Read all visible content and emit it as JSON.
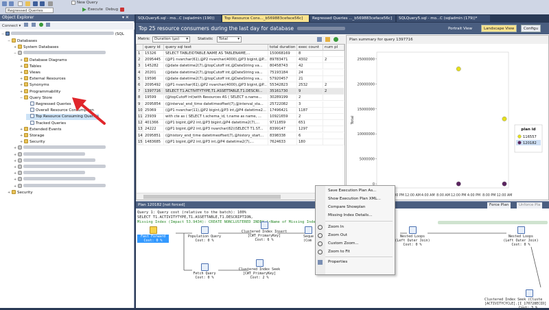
{
  "toolbar": {
    "regressed_label": "Regressed Queries",
    "new_query_label": "New Query",
    "execute_label": "Execute",
    "debug_label": "Debug"
  },
  "object_explorer": {
    "title": "Object Explorer",
    "connect_label": "Connect",
    "server_suffix": "(SQL",
    "tree": [
      {
        "label": "Databases",
        "indent": 1,
        "expander": "−",
        "icon": "folder"
      },
      {
        "label": "System Databases",
        "indent": 2,
        "expander": "+",
        "icon": "folder"
      },
      {
        "label": "",
        "indent": 2,
        "expander": "−",
        "icon": "db",
        "blurred": true
      },
      {
        "label": "Database Diagrams",
        "indent": 3,
        "expander": "+",
        "icon": "folder"
      },
      {
        "label": "Tables",
        "indent": 3,
        "expander": "+",
        "icon": "folder"
      },
      {
        "label": "Views",
        "indent": 3,
        "expander": "+",
        "icon": "folder"
      },
      {
        "label": "External Resources",
        "indent": 3,
        "expander": "+",
        "icon": "folder"
      },
      {
        "label": "Synonyms",
        "indent": 3,
        "expander": "+",
        "icon": "folder"
      },
      {
        "label": "Programmability",
        "indent": 3,
        "expander": "+",
        "icon": "folder"
      },
      {
        "label": "Query Store",
        "indent": 3,
        "expander": "−",
        "icon": "folder"
      },
      {
        "label": "Regressed Queries",
        "indent": 4,
        "expander": "",
        "icon": "report"
      },
      {
        "label": "Overall Resource Consumption",
        "indent": 4,
        "expander": "",
        "icon": "report"
      },
      {
        "label": "Top Resource Consuming Queries",
        "indent": 4,
        "expander": "",
        "icon": "report"
      },
      {
        "label": "Tracked Queries",
        "indent": 4,
        "expander": "",
        "icon": "report"
      },
      {
        "label": "Extended Events",
        "indent": 3,
        "expander": "+",
        "icon": "folder"
      },
      {
        "label": "Storage",
        "indent": 3,
        "expander": "+",
        "icon": "folder"
      },
      {
        "label": "Security",
        "indent": 3,
        "expander": "+",
        "icon": "folder"
      },
      {
        "label": "",
        "indent": 2,
        "expander": "+",
        "icon": "db",
        "blurred": true
      },
      {
        "label": "",
        "indent": 2,
        "expander": "+",
        "icon": "db",
        "blurred": true
      },
      {
        "label": "",
        "indent": 2,
        "expander": "+",
        "icon": "db",
        "blurred": true
      },
      {
        "label": "",
        "indent": 2,
        "expander": "+",
        "icon": "db",
        "blurred": true
      },
      {
        "label": "",
        "indent": 2,
        "expander": "+",
        "icon": "db",
        "blurred": true
      },
      {
        "label": "",
        "indent": 2,
        "expander": "+",
        "icon": "db",
        "blurred": true
      },
      {
        "label": "",
        "indent": 2,
        "expander": "+",
        "icon": "db",
        "blurred": true
      },
      {
        "label": "Security",
        "indent": 1,
        "expander": "+",
        "icon": "folder"
      }
    ]
  },
  "tabs": [
    {
      "label": "SQLQuery6.sql - mo...C (sqladmin (190))",
      "active": false
    },
    {
      "label": "Top Resource Cons..._b569883ceface56c]",
      "active": true
    },
    {
      "label": "Regressed Queries ..._b569883ceface56c]",
      "active": false
    },
    {
      "label": "SQLQuery5.sql - mo...C (sqladmin (179))*",
      "active": false
    }
  ],
  "document": {
    "header": "Top 25 resource consumers during the last day for database",
    "portrait_label": "Portrait View",
    "landscape_label": "Landscape View",
    "configure_label": "Configu",
    "metric_label": "Metric",
    "metric_value": "Duration (µs)",
    "statistic_label": "Statistic",
    "statistic_value": "Total"
  },
  "grid": {
    "columns": [
      "query id",
      "query sql text",
      "total duration",
      "exec count",
      "num pl"
    ],
    "rows": [
      [
        "1",
        "15326",
        "SELECT TABLEIDTABLE.NAME AS TABLENAME,...",
        "150068169",
        "8",
        ""
      ],
      [
        "2",
        "2095445",
        "(@P1 nvarchar(61),@P2 nvarchar(4000),@P3 bigint,@P...",
        "89783471",
        "4302",
        "2"
      ],
      [
        "3",
        "145282",
        "(@date datetime2(7),@topCutoff int,@DateString va...",
        "80458743",
        "42",
        ""
      ],
      [
        "4",
        "20201",
        "(@date datetime2(7),@topCutoff int,@DateString va...",
        "75193184",
        "24",
        ""
      ],
      [
        "5",
        "19596",
        "(@date datetime2(7),@topCutoff int,@DateString va...",
        "57920457",
        "21",
        ""
      ],
      [
        "6",
        "2095492",
        "(@P1 nvarchar(61),@P2 nvarchar(4000),@P3 bigint,@P...",
        "55342823",
        "2532",
        "2"
      ],
      [
        "7",
        "1397716",
        "SELECT T1.ACTIVITYTYPE,T1.ASSETTABLE,T1.DESCRI...",
        "35161730",
        "9",
        "2"
      ],
      [
        "8",
        "19599",
        "(@topCutoff int)with Resources AS ( SELECT o.name...",
        "30289199",
        "2",
        ""
      ],
      [
        "9",
        "2095854",
        "(@interval_end_time datetimeoffset(7),@interval_sta...",
        "25722082",
        "3",
        ""
      ],
      [
        "10",
        "25069",
        "(@P1 nvarchar(11),@P2 bigint,@P3 int,@P4 datetime2...",
        "17496421",
        "1187",
        ""
      ],
      [
        "11",
        "23939",
        "with cte as ( SELECT t.schema_id, t.name as name, ...",
        "10921659",
        "2",
        ""
      ],
      [
        "12",
        "401366",
        "(@P1 bigint,@P2 int,@P3 bigint,@P4 datetime2(7),...",
        "9711859",
        "651",
        ""
      ],
      [
        "13",
        "24222",
        "(@P1 bigint,@P2 int,@P3 nvarchar(82))SELECT T1.ST...",
        "8399147",
        "1297",
        ""
      ],
      [
        "14",
        "2095851",
        "(@history_end_time datetimeoffset(7),@history_start...",
        "8398338",
        "6",
        ""
      ],
      [
        "15",
        "1483685",
        "(@P1 bigint,@P2 int,@P3 int,@P4 datetime2(7),...",
        "7624633",
        "180",
        ""
      ]
    ]
  },
  "plot_summary": {
    "title": "Plan summary for query 1397716",
    "ylabel": "Total",
    "legend_title": "plan id",
    "legend_items": [
      "116557",
      "120182"
    ]
  },
  "chart_data": {
    "type": "scatter",
    "title": "Plan summary for query 1397716",
    "ylabel": "Total",
    "y_ticks": [
      "25000000",
      "20000000",
      "15000000",
      "10000000",
      "5000000",
      "0"
    ],
    "x_ticks": [
      "4:00 PM",
      "8:00 PM",
      "12:00 AM",
      "4:00 AM",
      "8:00 AM",
      "12:00 PM",
      "4:00 PM",
      "8:00 PM",
      "12:00 AM"
    ],
    "ylim": [
      0,
      25000000
    ],
    "series": [
      {
        "name": "116557",
        "color": "#e5df1c",
        "points": [
          {
            "x": "12:00 PM",
            "y": 23000000
          },
          {
            "x": "12:00 AM",
            "y": 13000000
          }
        ]
      },
      {
        "name": "120182",
        "color": "#5b2460",
        "points": [
          {
            "x": "12:00 PM",
            "y": 0
          },
          {
            "x": "12:00 AM",
            "y": 0
          }
        ]
      }
    ],
    "legend_placement": "right"
  },
  "plan": {
    "bar_title": "Plan 120182 [not forced]",
    "force_label": "Force Plan",
    "unforce_label": "Unforce Pla",
    "line1": "Query 1: Query cost (relative to the batch): 100%",
    "line2": "SELECT T1.ACTIVITYTYPE,T1.ASSETTABLE,T1.DESCRIPTION,",
    "line3": "Missing Index (Impact 53.9434): CREATE NONCLUSTERED INDEX [<Name of Missing Index, sysname,>] ON [dbo]",
    "operators": {
      "fast_forward": {
        "name": "Fast Forward",
        "cost": "Cost: 0 %"
      },
      "population_query": {
        "name": "Population Query",
        "cost": "Cost: 0 %"
      },
      "fetch_query": {
        "name": "Fetch Query",
        "cost": "Cost: 0 %"
      },
      "ci_insert": {
        "name": "Clustered Index Insert",
        "sub": "[CWT_PrimaryKey]",
        "cost": "Cost: 6 %"
      },
      "ci_seek1": {
        "name": "Clustered Index Seek",
        "sub": "[CWT_PrimaryKey]",
        "cost": "Cost: 2 %"
      },
      "seq": {
        "name": "Seque",
        "sub": "(Com"
      },
      "nl1": {
        "name": "Nested Loops",
        "sub": "(Left Outer Join)",
        "cost": "Cost: 0 %"
      },
      "nl2": {
        "name": "Nested Loops",
        "sub": "(Left Outer Join)",
        "cost": "Cost: 0 %"
      },
      "ci_seek2": {
        "name": "Clustered Index Seek (Cluste",
        "sub": "[ACTIVITYCYCLE].[I_170728ECID]",
        "cost": "Cost: 3 %"
      }
    }
  },
  "context_menu": {
    "items": [
      "Save Execution Plan As...",
      "Show Execution Plan XML...",
      "Compare Showplan",
      "Missing Index Details...",
      "Zoom In",
      "Zoom Out",
      "Custom Zoom...",
      "Zoom to Fit",
      "Properties"
    ]
  },
  "colors": {
    "chrome": "#293955",
    "active_tab": "#fbe38e",
    "series_yellow": "#e5df1c",
    "series_purple": "#5b2460",
    "arrow": "#e0262b",
    "selected_op": "#3399ff"
  }
}
